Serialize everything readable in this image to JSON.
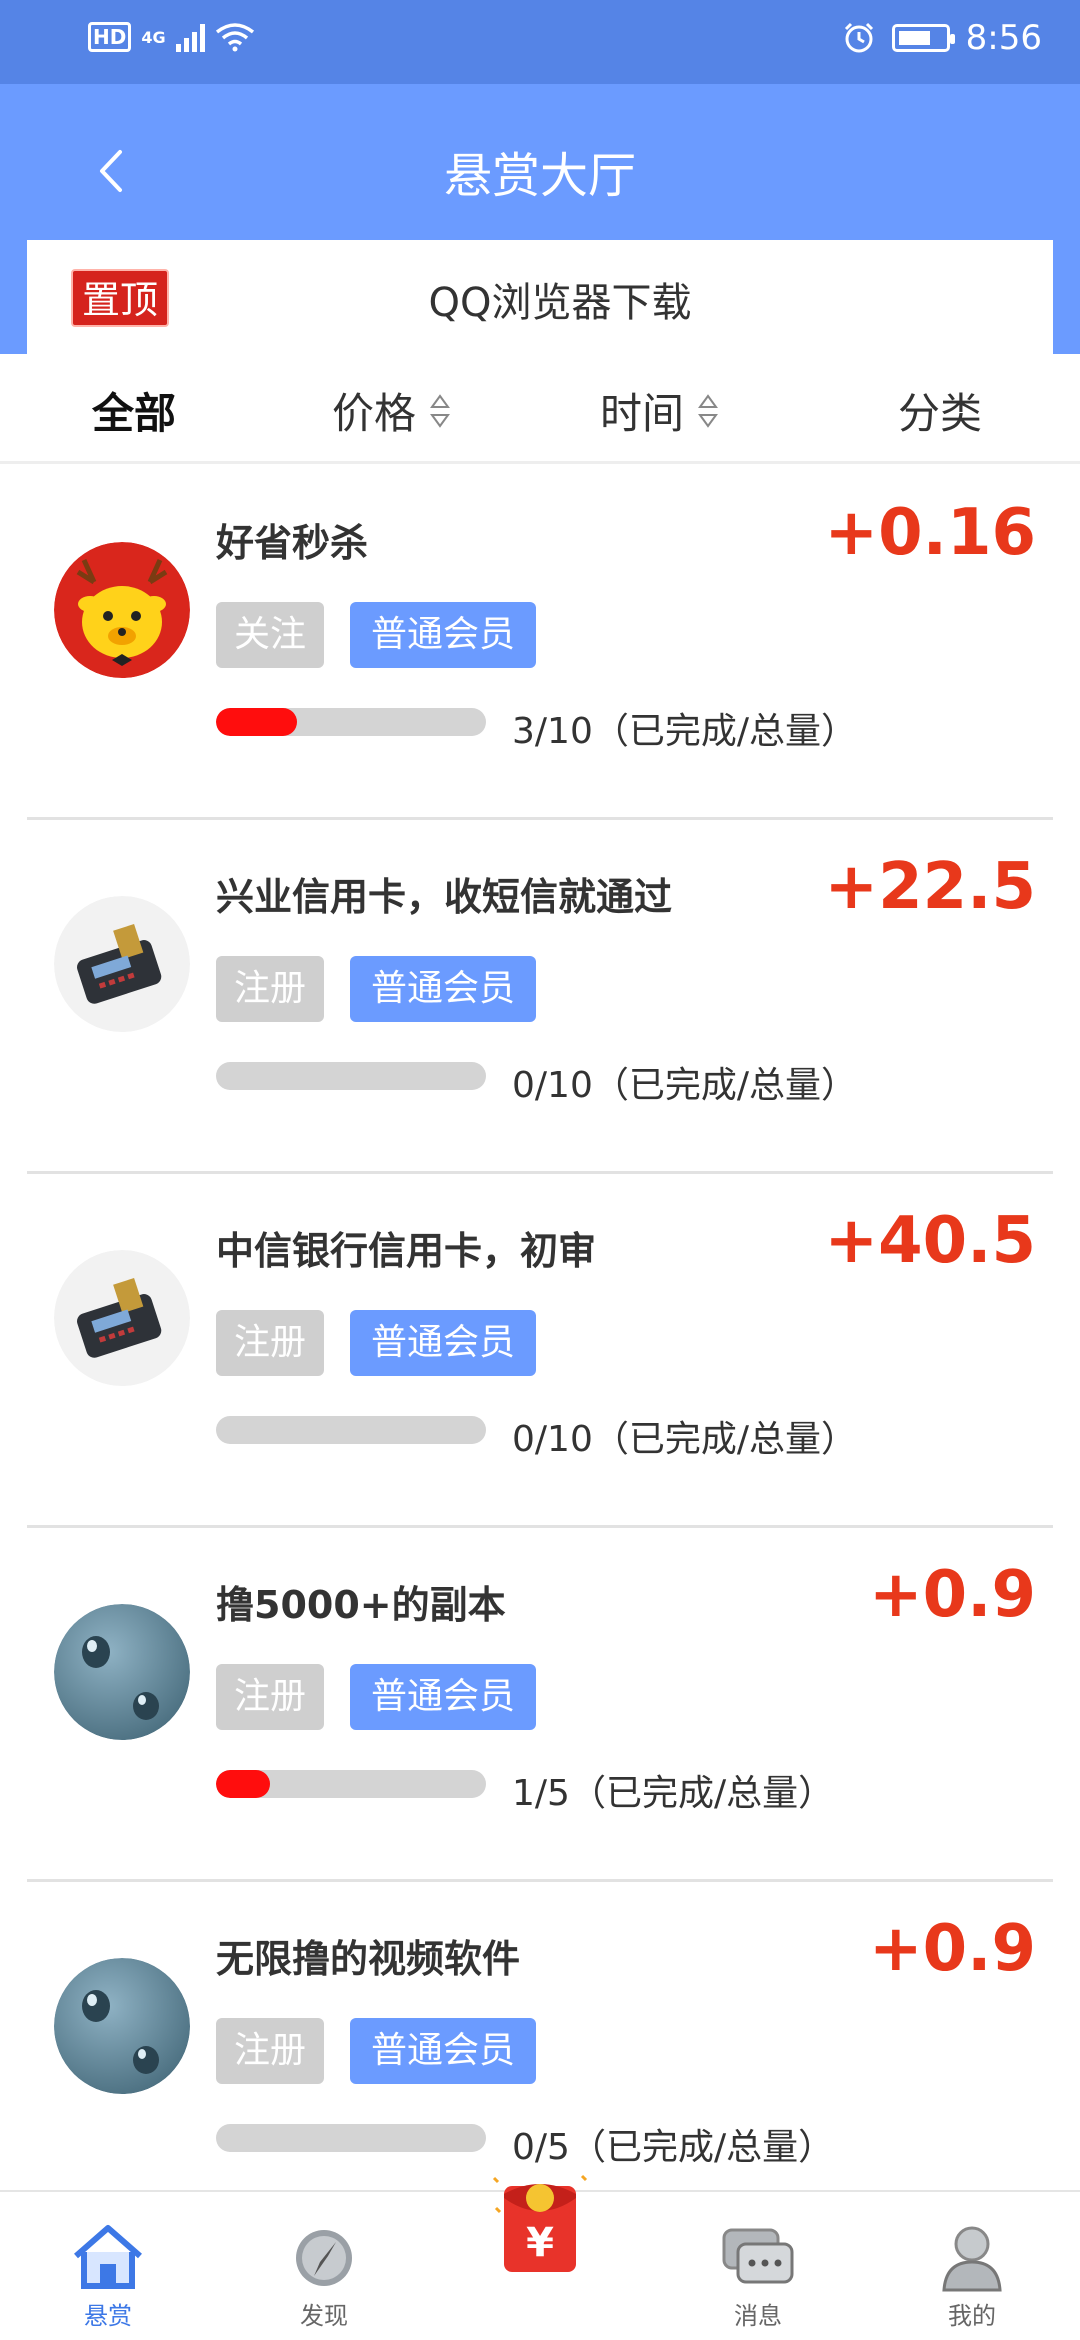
{
  "status_bar": {
    "network_badge": "HD",
    "signal_label": "4G",
    "time": "8:56"
  },
  "header": {
    "title": "悬赏大厅",
    "pinned_badge": "置顶",
    "pinned_text": "QQ浏览器下载"
  },
  "filters": {
    "all": "全部",
    "price": "价格",
    "time": "时间",
    "category": "分类"
  },
  "tasks": [
    {
      "title": "好省秒杀",
      "price": "+0.16",
      "tag1": "关注",
      "tag2": "普通会员",
      "progress_text": "3/10（已完成/总量）",
      "progress": 0.3,
      "avatar": "deer-logo"
    },
    {
      "title": "兴业信用卡，收短信就通过",
      "price": "+22.5",
      "tag1": "注册",
      "tag2": "普通会员",
      "progress_text": "0/10（已完成/总量）",
      "progress": 0.0,
      "avatar": "pos-terminal"
    },
    {
      "title": "中信银行信用卡，初审",
      "price": "+40.5",
      "tag1": "注册",
      "tag2": "普通会员",
      "progress_text": "0/10（已完成/总量）",
      "progress": 0.0,
      "avatar": "pos-terminal"
    },
    {
      "title": "撸5000+的副本",
      "price": "+0.9",
      "tag1": "注册",
      "tag2": "普通会员",
      "progress_text": "1/5（已完成/总量）",
      "progress": 0.2,
      "avatar": "water-drops"
    },
    {
      "title": "无限撸的视频软件",
      "price": "+0.9",
      "tag1": "注册",
      "tag2": "普通会员",
      "progress_text": "0/5（已完成/总量）",
      "progress": 0.0,
      "avatar": "water-drops"
    }
  ],
  "tabbar": {
    "bounty": "悬赏",
    "discover": "发现",
    "center_glyph": "¥",
    "messages": "消息",
    "mine": "我的"
  },
  "colors": {
    "header": "#6b9bff",
    "price": "#e8381b",
    "progress": "#ff0d0d"
  }
}
